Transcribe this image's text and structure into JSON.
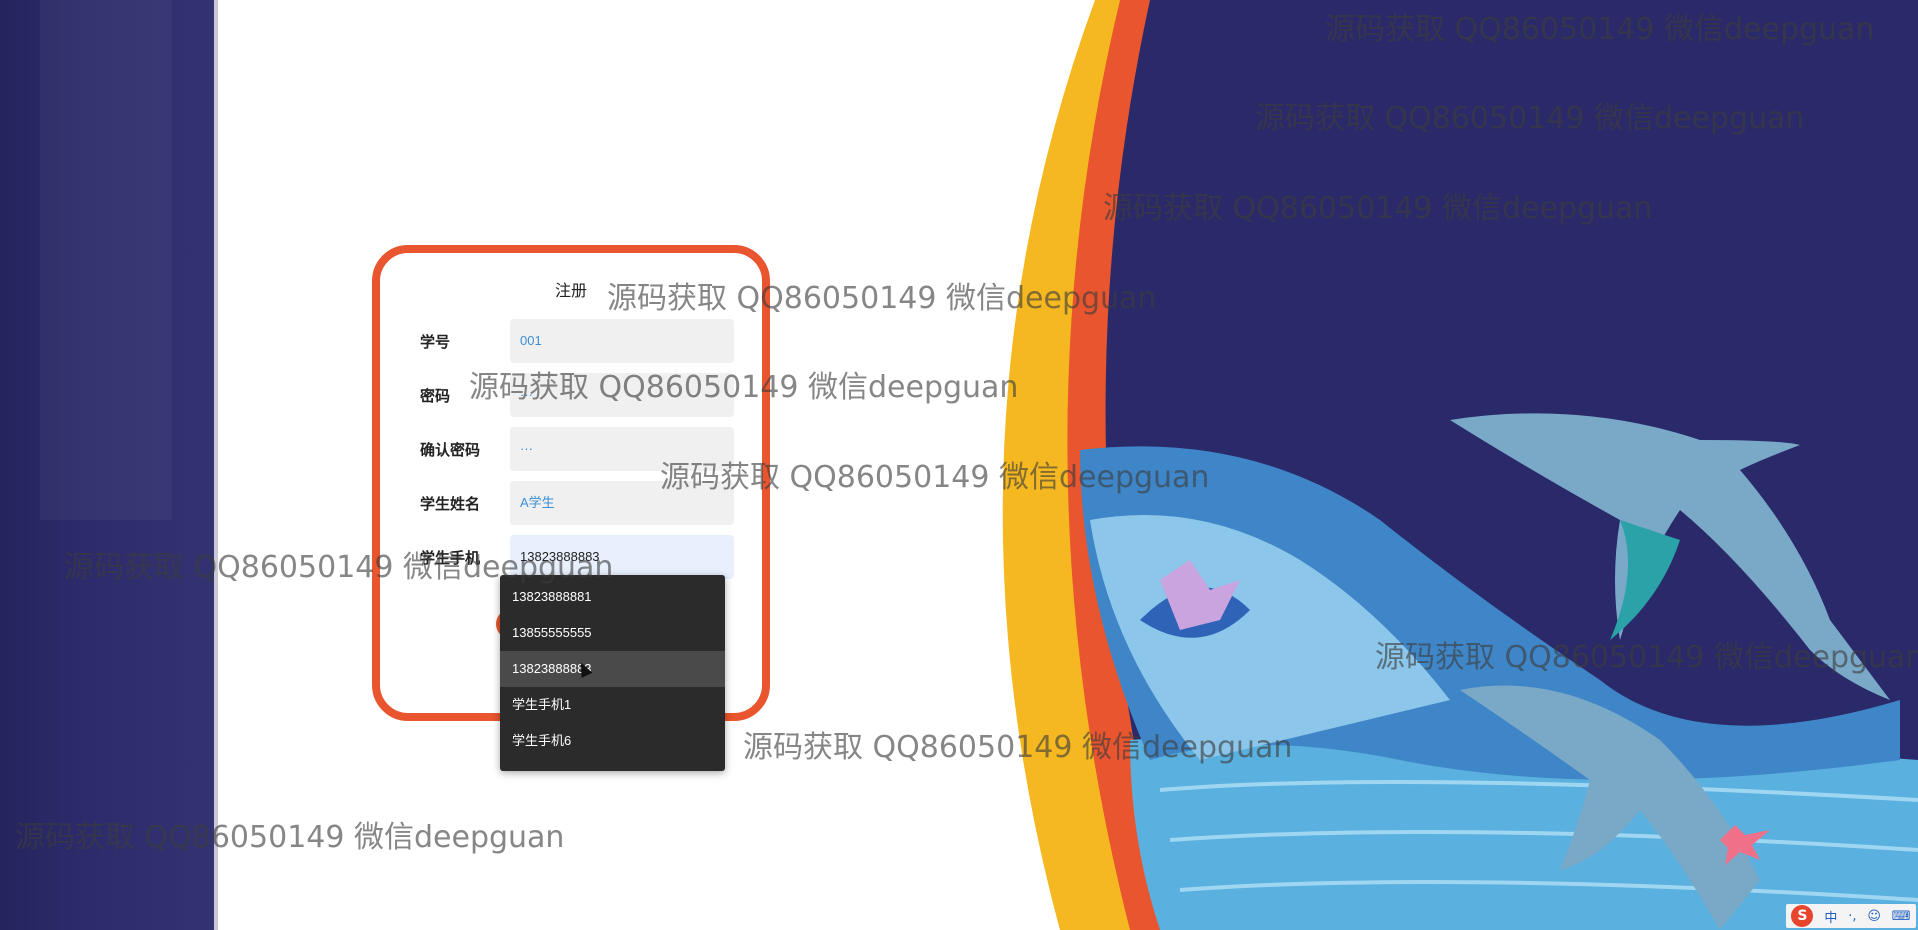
{
  "form": {
    "title": "注册",
    "fields": [
      {
        "label": "学号",
        "value": "001"
      },
      {
        "label": "密码",
        "value": "···"
      },
      {
        "label": "确认密码",
        "value": "···"
      },
      {
        "label": "学生姓名",
        "value": "A学生"
      },
      {
        "label": "学生手机",
        "value": "13823888883"
      }
    ]
  },
  "autocomplete": {
    "options": [
      "13823888881",
      "13855555555",
      "13823888883",
      "学生手机1",
      "学生手机6"
    ],
    "hovered_index": 2
  },
  "watermark": {
    "text": "源码获取 QQ86050149 微信deepguan"
  },
  "ime": {
    "logo": "S",
    "mode": "中",
    "punct": "·,",
    "emoji_icon": "smile-icon",
    "keyboard_icon": "keyboard-icon"
  },
  "colors": {
    "accent": "#e8552f",
    "navy": "#2a2a6a",
    "yellow": "#f5b820",
    "dropdown_bg": "#2b2b2b",
    "link_blue": "#3a8fd6"
  }
}
